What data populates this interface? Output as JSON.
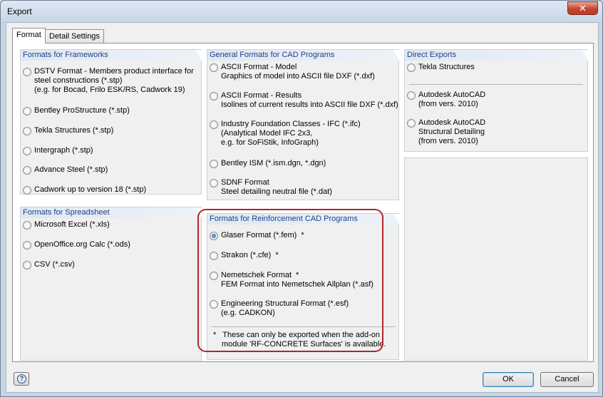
{
  "window": {
    "title": "Export",
    "close_label": "✕"
  },
  "tabs": [
    {
      "label": "Format",
      "active": true
    },
    {
      "label": "Detail Settings",
      "active": false
    }
  ],
  "frameworks": {
    "header": "Formats for Frameworks",
    "options": [
      {
        "lines": [
          "DSTV Format - Members product interface for",
          "steel constructions (*.stp)",
          "(e.g. for Bocad, Frilo ESK/RS, Cadwork 19)"
        ]
      },
      {
        "lines": [
          "Bentley ProStructure (*.stp)"
        ]
      },
      {
        "lines": [
          "Tekla Structures (*.stp)"
        ]
      },
      {
        "lines": [
          "Intergraph (*.stp)"
        ]
      },
      {
        "lines": [
          "Advance Steel (*.stp)"
        ]
      },
      {
        "lines": [
          "Cadwork up to version 18 (*.stp)"
        ]
      }
    ]
  },
  "spreadsheet": {
    "header": "Formats for Spreadsheet",
    "options": [
      {
        "lines": [
          "Microsoft Excel (*.xls)"
        ]
      },
      {
        "lines": [
          "OpenOffice.org Calc (*.ods)"
        ]
      },
      {
        "lines": [
          "CSV (*.csv)"
        ]
      }
    ]
  },
  "cad": {
    "header": "General Formats for CAD Programs",
    "options": [
      {
        "lines": [
          "ASCII Format - Model",
          "Graphics of model into ASCII file DXF (*.dxf)"
        ]
      },
      {
        "lines": [
          "ASCII Format - Results",
          "Isolines of current results into ASCII file DXF (*.dxf)"
        ]
      },
      {
        "lines": [
          "Industry Foundation Classes - IFC (*.ifc)",
          "(Analytical Model IFC 2x3,",
          "e.g. for SoFiStik, InfoGraph)"
        ]
      },
      {
        "lines": [
          "Bentley ISM (*.ism.dgn, *.dgn)"
        ]
      },
      {
        "lines": [
          "SDNF Format",
          "Steel detailing neutral file (*.dat)"
        ]
      }
    ]
  },
  "reinforcement": {
    "header": "Formats for Reinforcement CAD Programs",
    "options": [
      {
        "lines": [
          "Glaser Format  (*.fem)"
        ],
        "star": "*",
        "selected": true
      },
      {
        "lines": [
          "Strakon (*.cfe)"
        ],
        "star": "*"
      },
      {
        "lines": [
          "Nemetschek Format",
          "FEM Format into Nemetschek Allplan (*.asf)"
        ],
        "star": "*"
      },
      {
        "lines": [
          "Engineering Structural Format (*.esf)",
          "(e.g. CADKON)"
        ]
      }
    ],
    "footnote_star": "*",
    "footnote_line1": "These can only be exported when the add-on",
    "footnote_line2": "module 'RF-CONCRETE Surfaces' is available."
  },
  "direct": {
    "header": "Direct Exports",
    "options": [
      {
        "lines": [
          "Tekla Structures"
        ]
      },
      {
        "lines": [
          "Autodesk AutoCAD",
          "(from vers. 2010)"
        ]
      },
      {
        "lines": [
          "Autodesk AutoCAD",
          "Structural Detailing",
          "(from vers. 2010)"
        ]
      }
    ]
  },
  "buttons": {
    "ok": "OK",
    "cancel": "Cancel",
    "help_glyph": "?"
  }
}
